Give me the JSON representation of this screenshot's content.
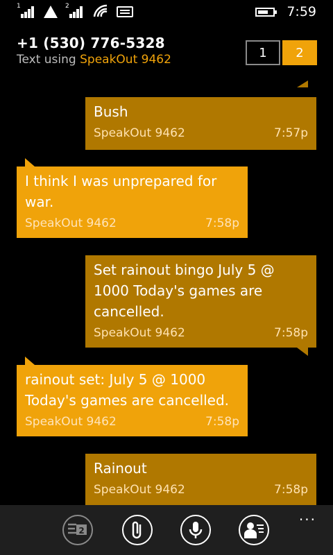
{
  "status": {
    "time": "7:59",
    "sim1": "1",
    "sim2": "2"
  },
  "header": {
    "phone": "+1 (530) 776-5328",
    "text_using": "Text using ",
    "account": "SpeakOut 9462"
  },
  "pages": {
    "one": "1",
    "two": "2"
  },
  "messages": [
    {
      "dir": "out",
      "text": "Bush",
      "sender": "SpeakOut 9462",
      "time": "7:57p"
    },
    {
      "dir": "in",
      "text": "I think I was unprepared for war.",
      "sender": "SpeakOut 9462",
      "time": "7:58p"
    },
    {
      "dir": "out",
      "text": "Set rainout bingo July 5 @ 1000 Today's games are cancelled.",
      "sender": "SpeakOut 9462",
      "time": "7:58p"
    },
    {
      "dir": "in",
      "text": "rainout set: July 5 @ 1000 Today's games are cancelled.",
      "sender": "SpeakOut 9462",
      "time": "7:58p"
    },
    {
      "dir": "out",
      "text": "Rainout",
      "sender": "SpeakOut 9462",
      "time": "7:58p"
    }
  ],
  "appbar": {
    "buttons": [
      "switch-sim-icon",
      "attach-icon",
      "microphone-icon",
      "contact-card-icon"
    ],
    "badge": "2",
    "more": "..."
  },
  "colors": {
    "incoming": "#f0a30a",
    "outgoing": "#b07800",
    "appbar": "#1f1f1f"
  }
}
